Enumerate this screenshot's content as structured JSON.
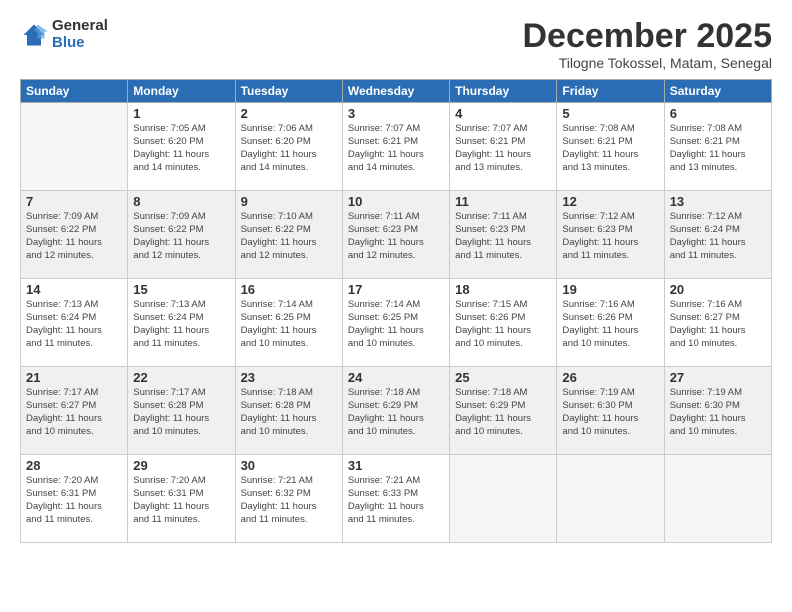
{
  "logo": {
    "general": "General",
    "blue": "Blue"
  },
  "header": {
    "month": "December 2025",
    "location": "Tilogne Tokossel, Matam, Senegal"
  },
  "days_of_week": [
    "Sunday",
    "Monday",
    "Tuesday",
    "Wednesday",
    "Thursday",
    "Friday",
    "Saturday"
  ],
  "weeks": [
    [
      {
        "day": "",
        "sunrise": "",
        "sunset": "",
        "daylight": ""
      },
      {
        "day": "1",
        "sunrise": "Sunrise: 7:05 AM",
        "sunset": "Sunset: 6:20 PM",
        "daylight": "Daylight: 11 hours and 14 minutes."
      },
      {
        "day": "2",
        "sunrise": "Sunrise: 7:06 AM",
        "sunset": "Sunset: 6:20 PM",
        "daylight": "Daylight: 11 hours and 14 minutes."
      },
      {
        "day": "3",
        "sunrise": "Sunrise: 7:07 AM",
        "sunset": "Sunset: 6:21 PM",
        "daylight": "Daylight: 11 hours and 14 minutes."
      },
      {
        "day": "4",
        "sunrise": "Sunrise: 7:07 AM",
        "sunset": "Sunset: 6:21 PM",
        "daylight": "Daylight: 11 hours and 13 minutes."
      },
      {
        "day": "5",
        "sunrise": "Sunrise: 7:08 AM",
        "sunset": "Sunset: 6:21 PM",
        "daylight": "Daylight: 11 hours and 13 minutes."
      },
      {
        "day": "6",
        "sunrise": "Sunrise: 7:08 AM",
        "sunset": "Sunset: 6:21 PM",
        "daylight": "Daylight: 11 hours and 13 minutes."
      }
    ],
    [
      {
        "day": "7",
        "sunrise": "Sunrise: 7:09 AM",
        "sunset": "Sunset: 6:22 PM",
        "daylight": "Daylight: 11 hours and 12 minutes."
      },
      {
        "day": "8",
        "sunrise": "Sunrise: 7:09 AM",
        "sunset": "Sunset: 6:22 PM",
        "daylight": "Daylight: 11 hours and 12 minutes."
      },
      {
        "day": "9",
        "sunrise": "Sunrise: 7:10 AM",
        "sunset": "Sunset: 6:22 PM",
        "daylight": "Daylight: 11 hours and 12 minutes."
      },
      {
        "day": "10",
        "sunrise": "Sunrise: 7:11 AM",
        "sunset": "Sunset: 6:23 PM",
        "daylight": "Daylight: 11 hours and 12 minutes."
      },
      {
        "day": "11",
        "sunrise": "Sunrise: 7:11 AM",
        "sunset": "Sunset: 6:23 PM",
        "daylight": "Daylight: 11 hours and 11 minutes."
      },
      {
        "day": "12",
        "sunrise": "Sunrise: 7:12 AM",
        "sunset": "Sunset: 6:23 PM",
        "daylight": "Daylight: 11 hours and 11 minutes."
      },
      {
        "day": "13",
        "sunrise": "Sunrise: 7:12 AM",
        "sunset": "Sunset: 6:24 PM",
        "daylight": "Daylight: 11 hours and 11 minutes."
      }
    ],
    [
      {
        "day": "14",
        "sunrise": "Sunrise: 7:13 AM",
        "sunset": "Sunset: 6:24 PM",
        "daylight": "Daylight: 11 hours and 11 minutes."
      },
      {
        "day": "15",
        "sunrise": "Sunrise: 7:13 AM",
        "sunset": "Sunset: 6:24 PM",
        "daylight": "Daylight: 11 hours and 11 minutes."
      },
      {
        "day": "16",
        "sunrise": "Sunrise: 7:14 AM",
        "sunset": "Sunset: 6:25 PM",
        "daylight": "Daylight: 11 hours and 10 minutes."
      },
      {
        "day": "17",
        "sunrise": "Sunrise: 7:14 AM",
        "sunset": "Sunset: 6:25 PM",
        "daylight": "Daylight: 11 hours and 10 minutes."
      },
      {
        "day": "18",
        "sunrise": "Sunrise: 7:15 AM",
        "sunset": "Sunset: 6:26 PM",
        "daylight": "Daylight: 11 hours and 10 minutes."
      },
      {
        "day": "19",
        "sunrise": "Sunrise: 7:16 AM",
        "sunset": "Sunset: 6:26 PM",
        "daylight": "Daylight: 11 hours and 10 minutes."
      },
      {
        "day": "20",
        "sunrise": "Sunrise: 7:16 AM",
        "sunset": "Sunset: 6:27 PM",
        "daylight": "Daylight: 11 hours and 10 minutes."
      }
    ],
    [
      {
        "day": "21",
        "sunrise": "Sunrise: 7:17 AM",
        "sunset": "Sunset: 6:27 PM",
        "daylight": "Daylight: 11 hours and 10 minutes."
      },
      {
        "day": "22",
        "sunrise": "Sunrise: 7:17 AM",
        "sunset": "Sunset: 6:28 PM",
        "daylight": "Daylight: 11 hours and 10 minutes."
      },
      {
        "day": "23",
        "sunrise": "Sunrise: 7:18 AM",
        "sunset": "Sunset: 6:28 PM",
        "daylight": "Daylight: 11 hours and 10 minutes."
      },
      {
        "day": "24",
        "sunrise": "Sunrise: 7:18 AM",
        "sunset": "Sunset: 6:29 PM",
        "daylight": "Daylight: 11 hours and 10 minutes."
      },
      {
        "day": "25",
        "sunrise": "Sunrise: 7:18 AM",
        "sunset": "Sunset: 6:29 PM",
        "daylight": "Daylight: 11 hours and 10 minutes."
      },
      {
        "day": "26",
        "sunrise": "Sunrise: 7:19 AM",
        "sunset": "Sunset: 6:30 PM",
        "daylight": "Daylight: 11 hours and 10 minutes."
      },
      {
        "day": "27",
        "sunrise": "Sunrise: 7:19 AM",
        "sunset": "Sunset: 6:30 PM",
        "daylight": "Daylight: 11 hours and 10 minutes."
      }
    ],
    [
      {
        "day": "28",
        "sunrise": "Sunrise: 7:20 AM",
        "sunset": "Sunset: 6:31 PM",
        "daylight": "Daylight: 11 hours and 11 minutes."
      },
      {
        "day": "29",
        "sunrise": "Sunrise: 7:20 AM",
        "sunset": "Sunset: 6:31 PM",
        "daylight": "Daylight: 11 hours and 11 minutes."
      },
      {
        "day": "30",
        "sunrise": "Sunrise: 7:21 AM",
        "sunset": "Sunset: 6:32 PM",
        "daylight": "Daylight: 11 hours and 11 minutes."
      },
      {
        "day": "31",
        "sunrise": "Sunrise: 7:21 AM",
        "sunset": "Sunset: 6:33 PM",
        "daylight": "Daylight: 11 hours and 11 minutes."
      },
      {
        "day": "",
        "sunrise": "",
        "sunset": "",
        "daylight": ""
      },
      {
        "day": "",
        "sunrise": "",
        "sunset": "",
        "daylight": ""
      },
      {
        "day": "",
        "sunrise": "",
        "sunset": "",
        "daylight": ""
      }
    ]
  ]
}
